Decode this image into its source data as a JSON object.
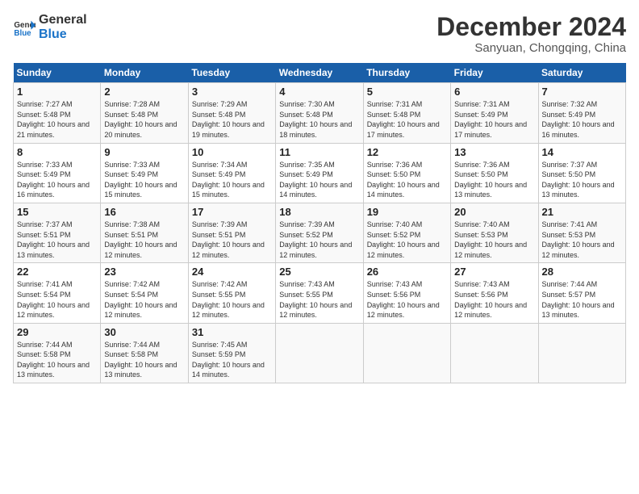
{
  "header": {
    "logo_line1": "General",
    "logo_line2": "Blue",
    "month_title": "December 2024",
    "subtitle": "Sanyuan, Chongqing, China"
  },
  "weekdays": [
    "Sunday",
    "Monday",
    "Tuesday",
    "Wednesday",
    "Thursday",
    "Friday",
    "Saturday"
  ],
  "weeks": [
    [
      {
        "day": "1",
        "sunrise": "Sunrise: 7:27 AM",
        "sunset": "Sunset: 5:48 PM",
        "daylight": "Daylight: 10 hours and 21 minutes."
      },
      {
        "day": "2",
        "sunrise": "Sunrise: 7:28 AM",
        "sunset": "Sunset: 5:48 PM",
        "daylight": "Daylight: 10 hours and 20 minutes."
      },
      {
        "day": "3",
        "sunrise": "Sunrise: 7:29 AM",
        "sunset": "Sunset: 5:48 PM",
        "daylight": "Daylight: 10 hours and 19 minutes."
      },
      {
        "day": "4",
        "sunrise": "Sunrise: 7:30 AM",
        "sunset": "Sunset: 5:48 PM",
        "daylight": "Daylight: 10 hours and 18 minutes."
      },
      {
        "day": "5",
        "sunrise": "Sunrise: 7:31 AM",
        "sunset": "Sunset: 5:48 PM",
        "daylight": "Daylight: 10 hours and 17 minutes."
      },
      {
        "day": "6",
        "sunrise": "Sunrise: 7:31 AM",
        "sunset": "Sunset: 5:49 PM",
        "daylight": "Daylight: 10 hours and 17 minutes."
      },
      {
        "day": "7",
        "sunrise": "Sunrise: 7:32 AM",
        "sunset": "Sunset: 5:49 PM",
        "daylight": "Daylight: 10 hours and 16 minutes."
      }
    ],
    [
      {
        "day": "8",
        "sunrise": "Sunrise: 7:33 AM",
        "sunset": "Sunset: 5:49 PM",
        "daylight": "Daylight: 10 hours and 16 minutes."
      },
      {
        "day": "9",
        "sunrise": "Sunrise: 7:33 AM",
        "sunset": "Sunset: 5:49 PM",
        "daylight": "Daylight: 10 hours and 15 minutes."
      },
      {
        "day": "10",
        "sunrise": "Sunrise: 7:34 AM",
        "sunset": "Sunset: 5:49 PM",
        "daylight": "Daylight: 10 hours and 15 minutes."
      },
      {
        "day": "11",
        "sunrise": "Sunrise: 7:35 AM",
        "sunset": "Sunset: 5:49 PM",
        "daylight": "Daylight: 10 hours and 14 minutes."
      },
      {
        "day": "12",
        "sunrise": "Sunrise: 7:36 AM",
        "sunset": "Sunset: 5:50 PM",
        "daylight": "Daylight: 10 hours and 14 minutes."
      },
      {
        "day": "13",
        "sunrise": "Sunrise: 7:36 AM",
        "sunset": "Sunset: 5:50 PM",
        "daylight": "Daylight: 10 hours and 13 minutes."
      },
      {
        "day": "14",
        "sunrise": "Sunrise: 7:37 AM",
        "sunset": "Sunset: 5:50 PM",
        "daylight": "Daylight: 10 hours and 13 minutes."
      }
    ],
    [
      {
        "day": "15",
        "sunrise": "Sunrise: 7:37 AM",
        "sunset": "Sunset: 5:51 PM",
        "daylight": "Daylight: 10 hours and 13 minutes."
      },
      {
        "day": "16",
        "sunrise": "Sunrise: 7:38 AM",
        "sunset": "Sunset: 5:51 PM",
        "daylight": "Daylight: 10 hours and 12 minutes."
      },
      {
        "day": "17",
        "sunrise": "Sunrise: 7:39 AM",
        "sunset": "Sunset: 5:51 PM",
        "daylight": "Daylight: 10 hours and 12 minutes."
      },
      {
        "day": "18",
        "sunrise": "Sunrise: 7:39 AM",
        "sunset": "Sunset: 5:52 PM",
        "daylight": "Daylight: 10 hours and 12 minutes."
      },
      {
        "day": "19",
        "sunrise": "Sunrise: 7:40 AM",
        "sunset": "Sunset: 5:52 PM",
        "daylight": "Daylight: 10 hours and 12 minutes."
      },
      {
        "day": "20",
        "sunrise": "Sunrise: 7:40 AM",
        "sunset": "Sunset: 5:53 PM",
        "daylight": "Daylight: 10 hours and 12 minutes."
      },
      {
        "day": "21",
        "sunrise": "Sunrise: 7:41 AM",
        "sunset": "Sunset: 5:53 PM",
        "daylight": "Daylight: 10 hours and 12 minutes."
      }
    ],
    [
      {
        "day": "22",
        "sunrise": "Sunrise: 7:41 AM",
        "sunset": "Sunset: 5:54 PM",
        "daylight": "Daylight: 10 hours and 12 minutes."
      },
      {
        "day": "23",
        "sunrise": "Sunrise: 7:42 AM",
        "sunset": "Sunset: 5:54 PM",
        "daylight": "Daylight: 10 hours and 12 minutes."
      },
      {
        "day": "24",
        "sunrise": "Sunrise: 7:42 AM",
        "sunset": "Sunset: 5:55 PM",
        "daylight": "Daylight: 10 hours and 12 minutes."
      },
      {
        "day": "25",
        "sunrise": "Sunrise: 7:43 AM",
        "sunset": "Sunset: 5:55 PM",
        "daylight": "Daylight: 10 hours and 12 minutes."
      },
      {
        "day": "26",
        "sunrise": "Sunrise: 7:43 AM",
        "sunset": "Sunset: 5:56 PM",
        "daylight": "Daylight: 10 hours and 12 minutes."
      },
      {
        "day": "27",
        "sunrise": "Sunrise: 7:43 AM",
        "sunset": "Sunset: 5:56 PM",
        "daylight": "Daylight: 10 hours and 12 minutes."
      },
      {
        "day": "28",
        "sunrise": "Sunrise: 7:44 AM",
        "sunset": "Sunset: 5:57 PM",
        "daylight": "Daylight: 10 hours and 13 minutes."
      }
    ],
    [
      {
        "day": "29",
        "sunrise": "Sunrise: 7:44 AM",
        "sunset": "Sunset: 5:58 PM",
        "daylight": "Daylight: 10 hours and 13 minutes."
      },
      {
        "day": "30",
        "sunrise": "Sunrise: 7:44 AM",
        "sunset": "Sunset: 5:58 PM",
        "daylight": "Daylight: 10 hours and 13 minutes."
      },
      {
        "day": "31",
        "sunrise": "Sunrise: 7:45 AM",
        "sunset": "Sunset: 5:59 PM",
        "daylight": "Daylight: 10 hours and 14 minutes."
      },
      null,
      null,
      null,
      null
    ]
  ]
}
